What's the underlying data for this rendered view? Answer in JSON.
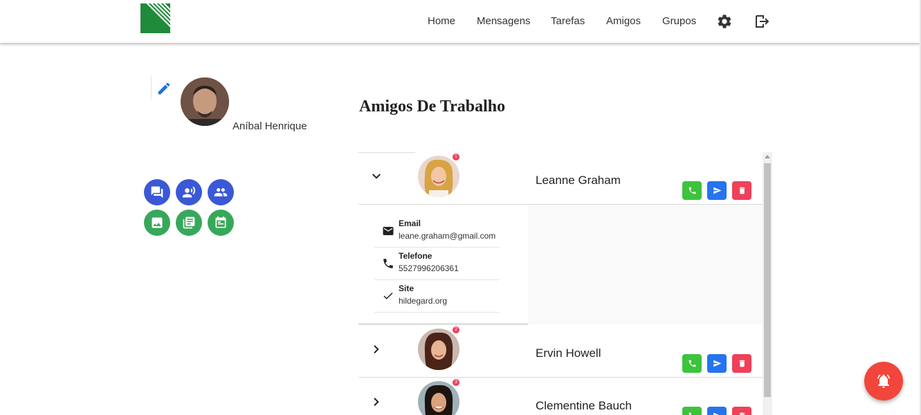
{
  "nav": {
    "logo": "logo-icon",
    "items": [
      {
        "label": "Home"
      },
      {
        "label": "Mensagens"
      },
      {
        "label": "Tarefas"
      },
      {
        "label": "Amigos"
      },
      {
        "label": "Grupos"
      }
    ],
    "settings_icon": "gear-icon",
    "logout_icon": "logout-icon"
  },
  "profile": {
    "name": "Aníbal Henrique",
    "edit_icon": "pencil-icon"
  },
  "quick_actions": [
    {
      "icon": "chat-icon",
      "color": "#3b58d6"
    },
    {
      "icon": "voice-icon",
      "color": "#3b58d6"
    },
    {
      "icon": "people-icon",
      "color": "#3b58d6"
    },
    {
      "icon": "image-icon",
      "color": "#37a85a"
    },
    {
      "icon": "article-icon",
      "color": "#37a85a"
    },
    {
      "icon": "calendar-icon",
      "color": "#37a85a"
    }
  ],
  "main": {
    "title": "Amigos De Trabalho",
    "friends": [
      {
        "name": "Leanne Graham",
        "badge": "1",
        "expanded": true
      },
      {
        "name": "Ervin Howell",
        "badge": "2",
        "expanded": false
      },
      {
        "name": "Clementine Bauch",
        "badge": "3",
        "expanded": false
      }
    ],
    "details": [
      {
        "label": "Email",
        "value": "leane.graham@gmail.com",
        "icon": "mail-icon"
      },
      {
        "label": "Telefone",
        "value": "5527996206361",
        "icon": "phone-icon"
      },
      {
        "label": "Site",
        "value": "hildegard.org",
        "icon": "check-icon"
      }
    ]
  },
  "colors": {
    "call": "#3dc33d",
    "message": "#2673f0",
    "delete": "#f0405a",
    "fab": "#f2453c"
  },
  "fab": {
    "icon": "alarm-bell-icon"
  }
}
